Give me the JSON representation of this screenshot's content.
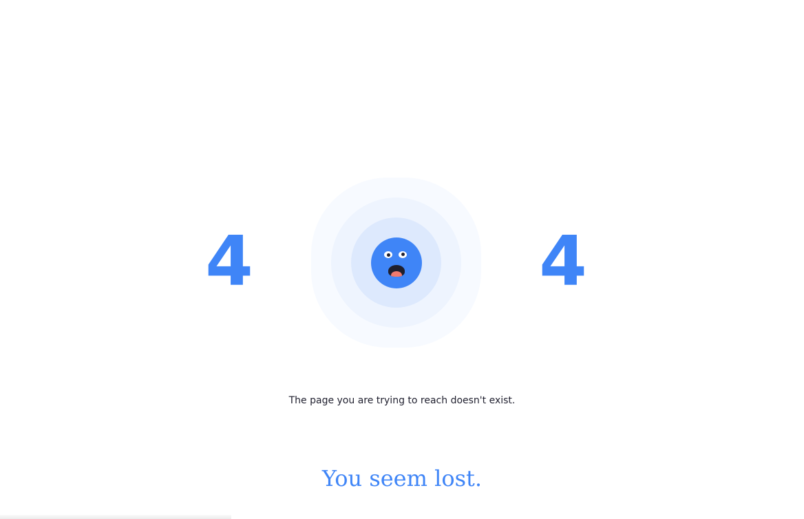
{
  "error_code": {
    "digit_left": "4",
    "digit_right": "4"
  },
  "illustration": {
    "icon": "shocked-face-icon"
  },
  "message": "The page you are trying to reach doesn't exist.",
  "headline": "You seem lost.",
  "colors": {
    "accent": "#3f85f7",
    "text": "#1f1f2e",
    "ring_outer": "#f7faff",
    "ring_middle": "#eef4fe",
    "ring_inner": "#dde9fd",
    "tongue": "#f07a6e"
  }
}
